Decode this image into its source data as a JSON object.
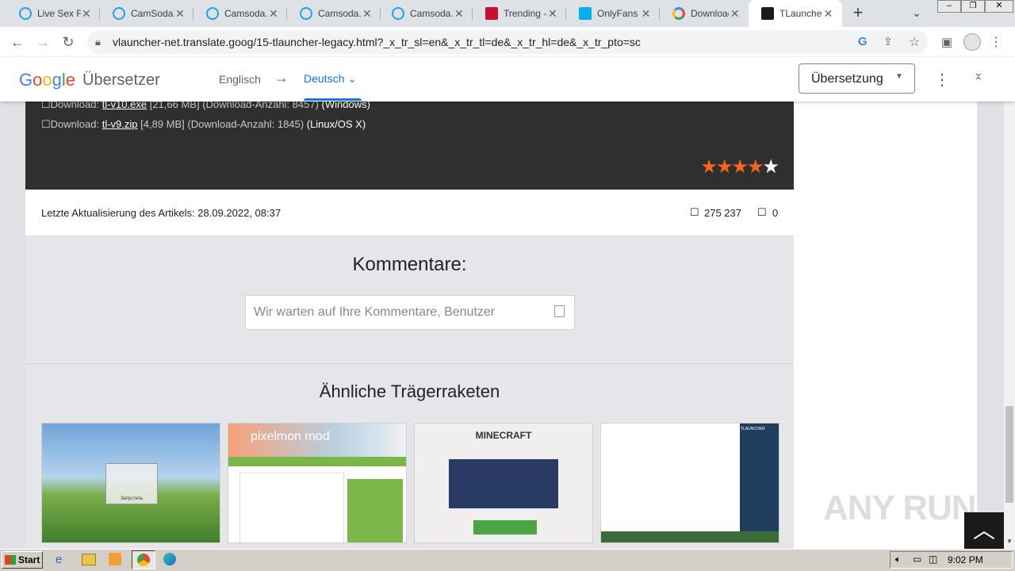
{
  "tabs": [
    {
      "label": "Live Sex Fr"
    },
    {
      "label": "CamSoda.c"
    },
    {
      "label": "Camsoda.c"
    },
    {
      "label": "Camsoda.c"
    },
    {
      "label": "Camsoda.c"
    },
    {
      "label": "Trending - I"
    },
    {
      "label": "OnlyFans I"
    },
    {
      "label": "Download"
    },
    {
      "label": "TLauncher"
    }
  ],
  "toolbar": {
    "url": "vlauncher-net.translate.goog/15-tlauncher-legacy.html?_x_tr_sl=en&_x_tr_tl=de&_x_tr_hl=de&_x_tr_pto=sc"
  },
  "translate": {
    "logo": "Google",
    "product": "Übersetzer",
    "source_lang": "Englisch",
    "arrow": "→",
    "target_lang": "Deutsch",
    "mode": "Übersetzung"
  },
  "downloads": [
    {
      "prefix": "Download:",
      "file": "tl-v10.exe",
      "size": "[21,66 MB]",
      "count": "(Download-Anzahl: 8457)",
      "os": "(Windows)"
    },
    {
      "prefix": "Download:",
      "file": "tl-v9.zip",
      "size": "[4,89 MB]",
      "count": "(Download-Anzahl: 1845)",
      "os": "(Linux/OS X)"
    }
  ],
  "rating": {
    "filled": "★★★★",
    "empty": "★",
    "value": 4,
    "max": 5,
    "color": "#f26522"
  },
  "article": {
    "updated": "Letzte Aktualisierung des Artikels: 28.09.2022, 08:37",
    "views": "275 237",
    "comments_count": "0"
  },
  "comments": {
    "heading": "Kommentare:",
    "placeholder": "Wir warten auf Ihre Kommentare, Benutzer"
  },
  "similar": {
    "heading": "Ähnliche Trägerraketen",
    "items": [
      {
        "caption": "",
        "thumb_text": "Запустить"
      },
      {
        "caption": "",
        "thumb_text": "pixelmon mod"
      },
      {
        "caption": "",
        "thumb_text": "MINECRAFT"
      },
      {
        "caption": "",
        "thumb_text": "TLAUNCHER"
      }
    ]
  },
  "watermark": "ANY RUN",
  "taskbar": {
    "start": "Start",
    "time": "9:02 PM"
  }
}
